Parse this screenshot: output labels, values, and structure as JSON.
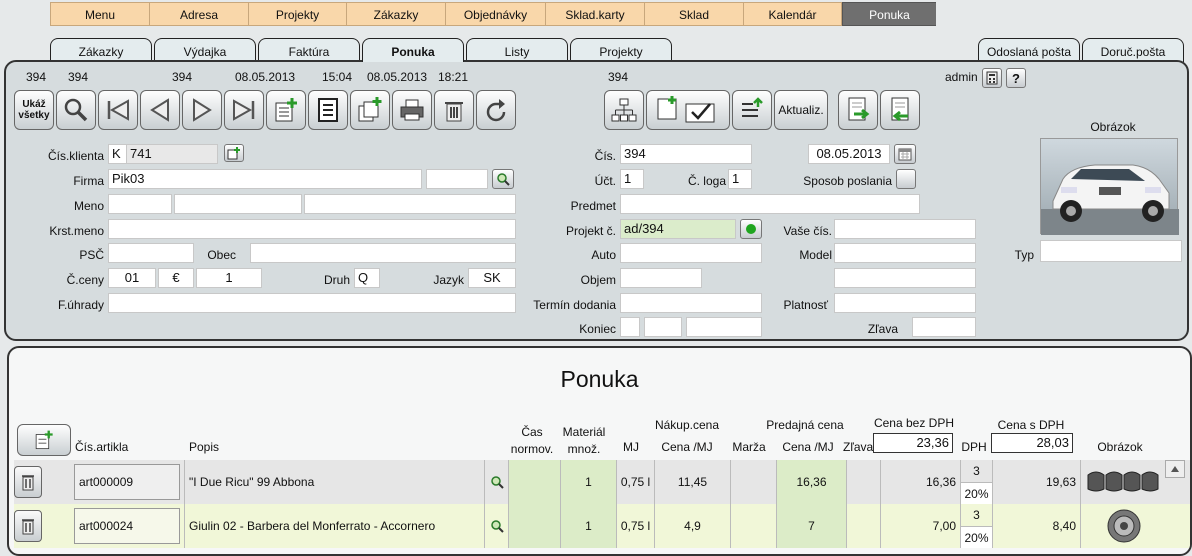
{
  "topnav": [
    "Menu",
    "Adresa",
    "Projekty",
    "Zákazky",
    "Objednávky",
    "Sklad.karty",
    "Sklad",
    "Kalendár",
    "Ponuka"
  ],
  "tabs": [
    "Zákazky",
    "Výdajka",
    "Faktúra",
    "Ponuka",
    "Listy",
    "Projekty",
    "Odoslaná pošta",
    "Doruč.pošta"
  ],
  "header": {
    "n1": "394",
    "n2": "394",
    "n3": "394",
    "date1": "08.05.2013",
    "time1": "15:04",
    "date2": "08.05.2013",
    "time2": "18:21",
    "n4": "394",
    "user": "admin"
  },
  "toolbar": {
    "show_all": "Ukáž všetky",
    "update": "Aktualiz."
  },
  "form": {
    "cis_klienta_label": "Čís.klienta",
    "cis_klienta_prefix": "K",
    "cis_klienta": "741",
    "firma_label": "Firma",
    "firma": "Pik03",
    "meno_label": "Meno",
    "krst_label": "Krst.meno",
    "psc_label": "PSČ",
    "obec_label": "Obec",
    "cceny_label": "Č.ceny",
    "cceny": "01",
    "currency": "€",
    "rate": "1",
    "druh_label": "Druh",
    "druh": "Q",
    "jazyk_label": "Jazyk",
    "jazyk": "SK",
    "fuhrady_label": "F.úhrady",
    "cis_label": "Čís.",
    "cis": "394",
    "date": "08.05.2013",
    "uct_label": "Účt.",
    "uct": "1",
    "cloga_label": "Č. loga",
    "cloga": "1",
    "sposob_label": "Sposob poslania",
    "predmet_label": "Predmet",
    "projekt_label": "Projekt č.",
    "projekt": "ad/394",
    "vase_label": "Vaše čís.",
    "auto_label": "Auto",
    "model_label": "Model",
    "objem_label": "Objem",
    "termin_label": "Termín dodania",
    "platnost_label": "Platnosť",
    "koniec_label": "Koniec",
    "zlava_label": "Zľava",
    "obrazok_label": "Obrázok",
    "typ_label": "Typ"
  },
  "grid": {
    "title": "Ponuka",
    "headers": {
      "cis": "Čís.artikla",
      "popis": "Popis",
      "cas": "Čas normov.",
      "mat": "Materiál množ.",
      "mj": "MJ",
      "nakup": "Nákup.cena",
      "cena_mj": "Cena /MJ",
      "marza": "Marža",
      "predaj": "Predajná cena",
      "cena_mj2": "Cena /MJ",
      "zlava": "Zľava",
      "bez_dph": "Cena bez DPH",
      "dph": "DPH",
      "s_dph": "Cena s DPH",
      "obrazok": "Obrázok"
    },
    "sum_bez_dph": "23,36",
    "sum_s_dph": "28,03",
    "rows": [
      {
        "art": "art000009",
        "popis": "\"I Due Ricu\" 99 Abbona",
        "mnoz": "1",
        "mj": "0,75 l",
        "nakup": "11,45",
        "predaj": "16,36",
        "bez_dph": "16,36",
        "dph_code": "3",
        "dph_pct": "20%",
        "s_dph": "19,63"
      },
      {
        "art": "art000024",
        "popis": "Giulin 02 - Barbera del Monferrato - Accornero",
        "mnoz": "1",
        "mj": "0,75 l",
        "nakup": "4,9",
        "predaj": "7",
        "bez_dph": "7,00",
        "dph_code": "3",
        "dph_pct": "20%",
        "s_dph": "8,40"
      }
    ]
  },
  "colors": {
    "nav": "#f9d7aa",
    "nav_active": "#6f6f6f",
    "row_green": "#dcecc8",
    "row2_bg": "#f1f7d8"
  }
}
